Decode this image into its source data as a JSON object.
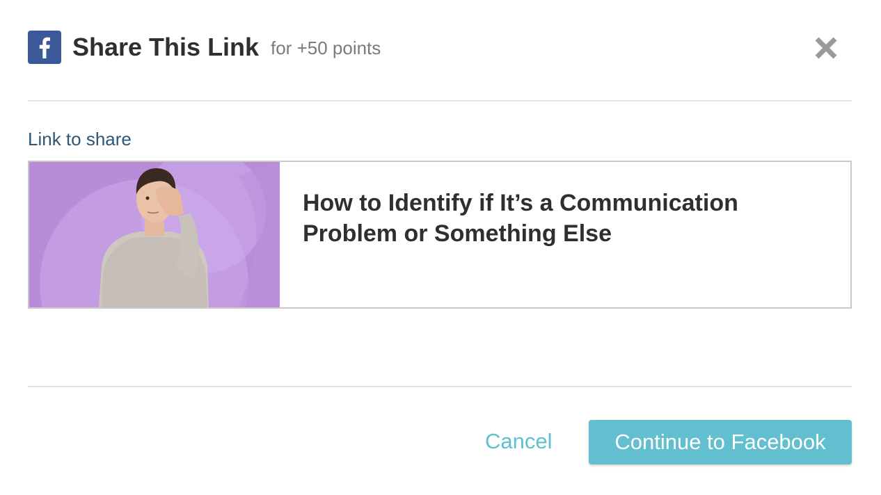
{
  "header": {
    "icon": "facebook-icon",
    "title": "Share This Link",
    "subtitle": "for +50 points",
    "close_icon": "close-icon"
  },
  "section": {
    "label": "Link to share"
  },
  "preview": {
    "title": "How to Identify if It’s a Communication Problem or Something Else",
    "thumbnail": "man-covering-eye-photo"
  },
  "footer": {
    "cancel_label": "Cancel",
    "continue_label": "Continue to Facebook"
  },
  "colors": {
    "facebook_blue": "#3b5998",
    "accent": "#62bfcf",
    "label_blue": "#2e5677",
    "thumb_bg": "#b98cd9"
  }
}
